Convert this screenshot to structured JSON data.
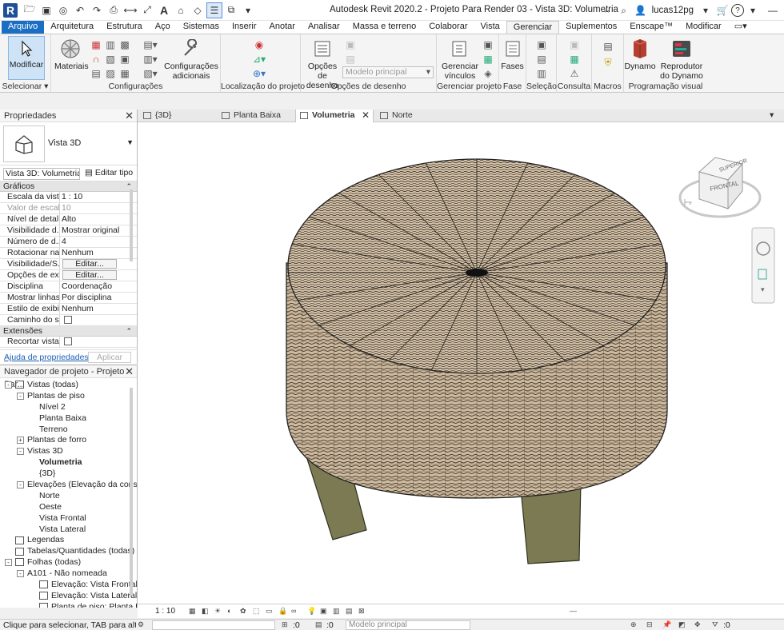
{
  "app": {
    "title": "Autodesk Revit 2020.2 - Projeto Para Render 03 - Vista 3D: Volumetria",
    "user": "lucas12pg",
    "help": "?"
  },
  "ribbon_tabs": [
    "Arquivo",
    "Arquitetura",
    "Estrutura",
    "Aço",
    "Sistemas",
    "Inserir",
    "Anotar",
    "Analisar",
    "Massa e terreno",
    "Colaborar",
    "Vista",
    "Gerenciar",
    "Suplementos",
    "Enscape™",
    "Modificar"
  ],
  "ribbon": {
    "modify_label": "Modificar",
    "select_panel": "Selecionar",
    "materials_label": "Materiais",
    "additional_settings_label": "Configurações adicionais",
    "settings_panel": "Configurações",
    "location_panel": "Localização do projeto",
    "design_options_label": "Opções de desenho",
    "main_model_value": "Modelo principal",
    "design_options_panel": "Opções de desenho",
    "manage_links_label": "Gerenciar vínculos",
    "manage_project_panel": "Gerenciar projeto",
    "phases_label": "Fases",
    "phase_panel": "Fase",
    "selection_panel": "Seleção",
    "inquiry_panel": "Consulta",
    "macros_panel": "Macros",
    "dynamo_label": "Dynamo",
    "dynamo_player_label": "Reprodutor do Dynamo",
    "visual_programming_panel": "Programação visual"
  },
  "properties": {
    "header": "Propriedades",
    "type_name": "Vista 3D",
    "view_selector": "Vista 3D: Volumetria",
    "edit_type": "Editar tipo",
    "section_graphics": "Gráficos",
    "rows": [
      {
        "name": "Escala da vista",
        "value": "1 : 10"
      },
      {
        "name": "Valor de escal...",
        "value": "10"
      },
      {
        "name": "Nível de detalhe",
        "value": "Alto"
      },
      {
        "name": "Visibilidade d...",
        "value": "Mostrar original"
      },
      {
        "name": "Número de d...",
        "value": "4"
      },
      {
        "name": "Rotacionar na...",
        "value": "Nenhum"
      },
      {
        "name": "Visibilidade/S...",
        "value": "Editar..."
      },
      {
        "name": "Opções de exi...",
        "value": "Editar..."
      },
      {
        "name": "Disciplina",
        "value": "Coordenação"
      },
      {
        "name": "Mostrar linhas...",
        "value": "Por disciplina"
      },
      {
        "name": "Estilo de exibi...",
        "value": "Nenhum"
      },
      {
        "name": "Caminho do sol",
        "value": ""
      }
    ],
    "section_extents": "Extensões",
    "crop_view": "Recortar vista",
    "help_link": "Ajuda de propriedades",
    "apply": "Aplicar"
  },
  "browser": {
    "header": "Navegador de projeto - Projeto Par...",
    "items": [
      {
        "label": "Vistas (todas)",
        "level": 0,
        "toggle": "-",
        "icon": true
      },
      {
        "label": "Plantas de piso",
        "level": 1,
        "toggle": "-"
      },
      {
        "label": "Nível 2",
        "level": 2
      },
      {
        "label": "Planta Baixa",
        "level": 2
      },
      {
        "label": "Terreno",
        "level": 2
      },
      {
        "label": "Plantas de forro",
        "level": 1,
        "toggle": "+"
      },
      {
        "label": "Vistas 3D",
        "level": 1,
        "toggle": "-"
      },
      {
        "label": "Volumetria",
        "level": 2,
        "bold": true
      },
      {
        "label": "{3D}",
        "level": 2
      },
      {
        "label": "Elevações (Elevação da const...",
        "level": 1,
        "toggle": "-"
      },
      {
        "label": "Norte",
        "level": 2
      },
      {
        "label": "Oeste",
        "level": 2
      },
      {
        "label": "Vista Frontal",
        "level": 2
      },
      {
        "label": "Vista Lateral",
        "level": 2
      },
      {
        "label": "Legendas",
        "level": 0,
        "icon": true
      },
      {
        "label": "Tabelas/Quantidades (todas)",
        "level": 0,
        "icon": true
      },
      {
        "label": "Folhas (todas)",
        "level": 0,
        "toggle": "-",
        "icon": true
      },
      {
        "label": "A101 - Não nomeada",
        "level": 1,
        "toggle": "-"
      },
      {
        "label": "Elevação: Vista Frontal",
        "level": 2,
        "icon": true
      },
      {
        "label": "Elevação: Vista Lateral",
        "level": 2,
        "icon": true
      },
      {
        "label": "Planta de piso: Planta B...",
        "level": 2,
        "icon": true
      }
    ]
  },
  "view_tabs": [
    {
      "label": "{3D}"
    },
    {
      "label": "Planta Baixa"
    },
    {
      "label": "Volumetria",
      "active": true
    },
    {
      "label": "Norte"
    }
  ],
  "viewcube": {
    "top": "SUPERIOR",
    "front": "FRONTAL"
  },
  "view_bar": {
    "scale": "1 : 10"
  },
  "status": {
    "text": "Clique para selecionar, TAB para alternat",
    "zero1": ":0",
    "zero2": ":0",
    "model": "Modelo principal",
    "filter": ":0"
  },
  "colors": {
    "file_tab": "#1a6fc4",
    "wicker": "#c8b49a",
    "legs": "#7b7a52"
  }
}
